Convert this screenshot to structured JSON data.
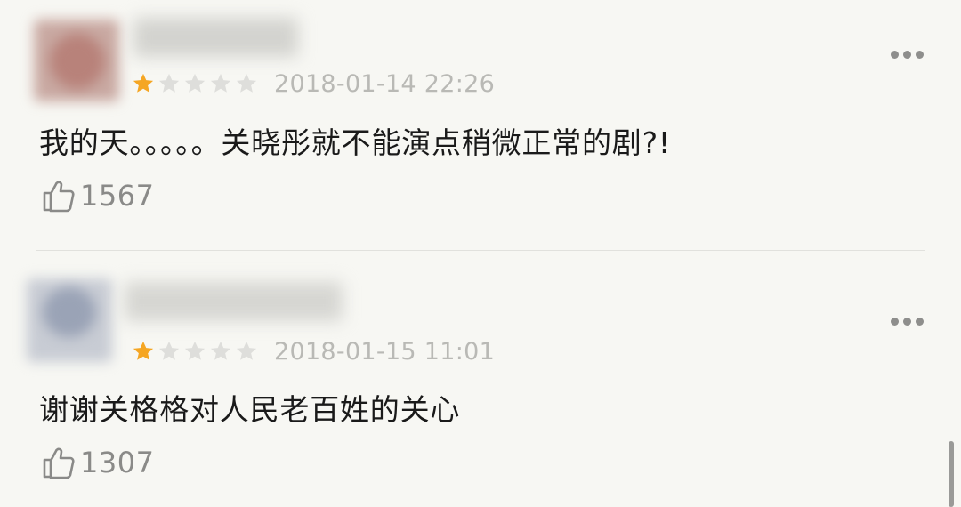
{
  "comments": [
    {
      "rating": 1,
      "max_rating": 5,
      "timestamp": "2018-01-14 22:26",
      "text": "我的天。。。。。关晓彤就不能演点稍微正常的剧?!",
      "likes": "1567"
    },
    {
      "rating": 1,
      "max_rating": 5,
      "timestamp": "2018-01-15 11:01",
      "text": "谢谢关格格对人民老百姓的关心",
      "likes": "1307"
    }
  ],
  "colors": {
    "background": "#f7f7f3",
    "star_filled": "#f5a623",
    "star_empty": "#dededb",
    "text": "#1a1a1a",
    "meta": "#b9b9b5"
  },
  "icons": {
    "like": "thumbs-up-icon",
    "more": "more-dots-icon",
    "star": "star-icon"
  }
}
